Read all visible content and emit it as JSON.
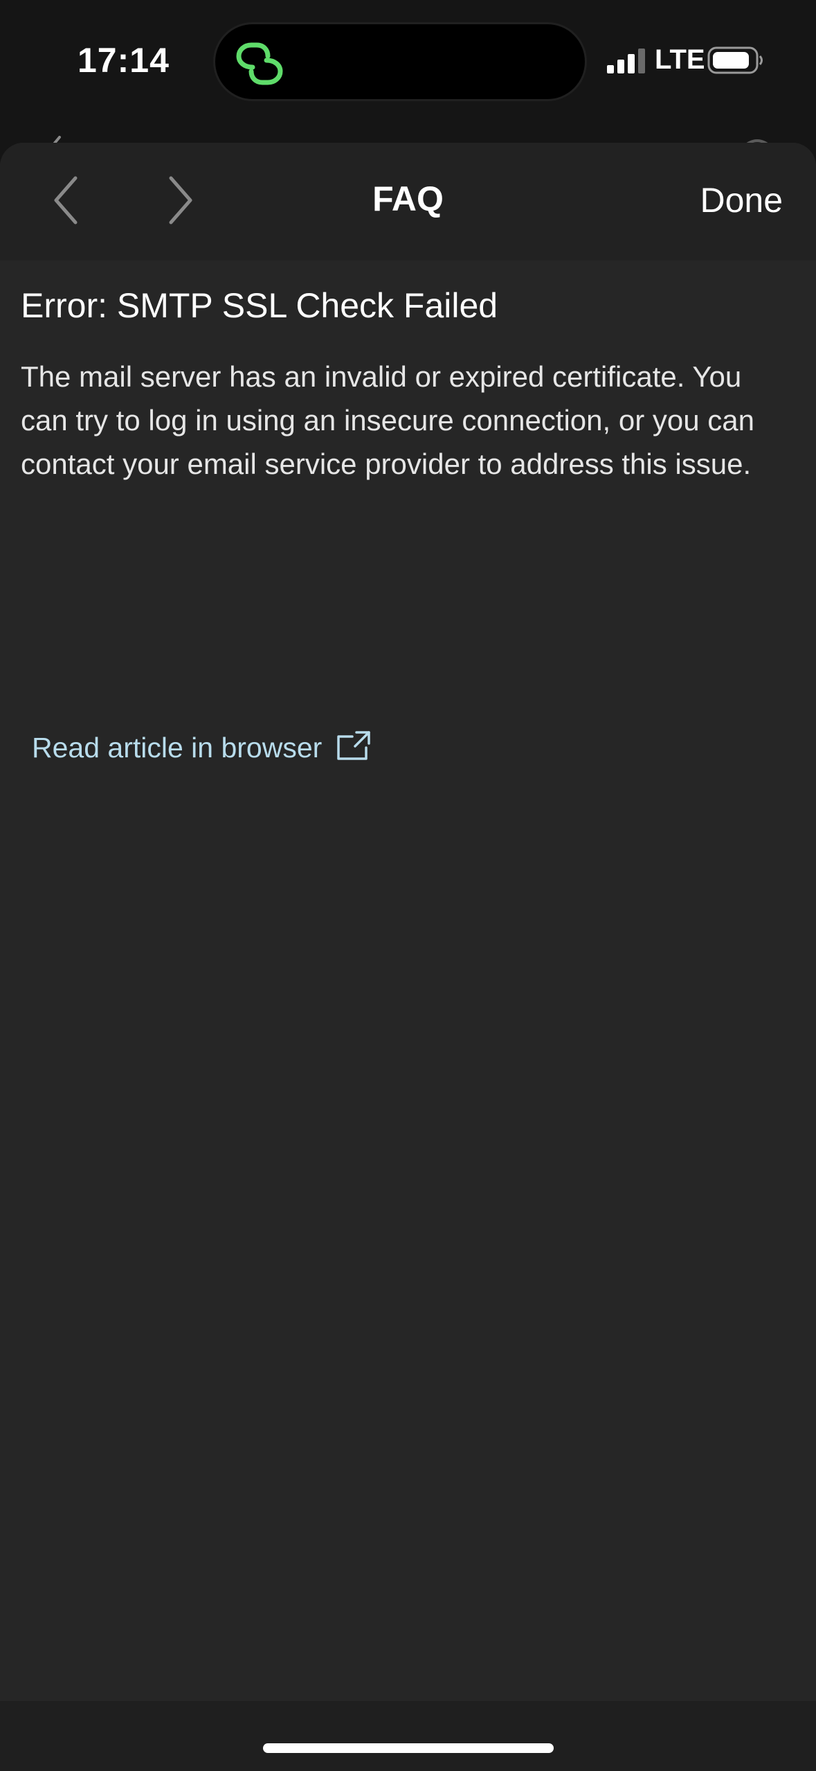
{
  "status_bar": {
    "time": "17:14",
    "network": "LTE",
    "island_icon": "link-icon",
    "colors": {
      "island_icon": "#5fdc6a"
    }
  },
  "nav": {
    "title": "FAQ",
    "done_label": "Done",
    "back_icon": "chevron-left-icon",
    "forward_icon": "chevron-right-icon"
  },
  "article": {
    "title": "Error: SMTP SSL Check Failed",
    "body": "The mail server has an invalid or expired certificate. You can try to log in using an insecure connection, or you can contact your email service provider to address this issue.",
    "link_label": "Read article in browser",
    "link_icon": "external-link-icon",
    "colors": {
      "link": "#b8dcec"
    }
  },
  "theme": {
    "sheet_bg": "#262626",
    "nav_bg": "#222222",
    "screen_bg": "#151515"
  }
}
